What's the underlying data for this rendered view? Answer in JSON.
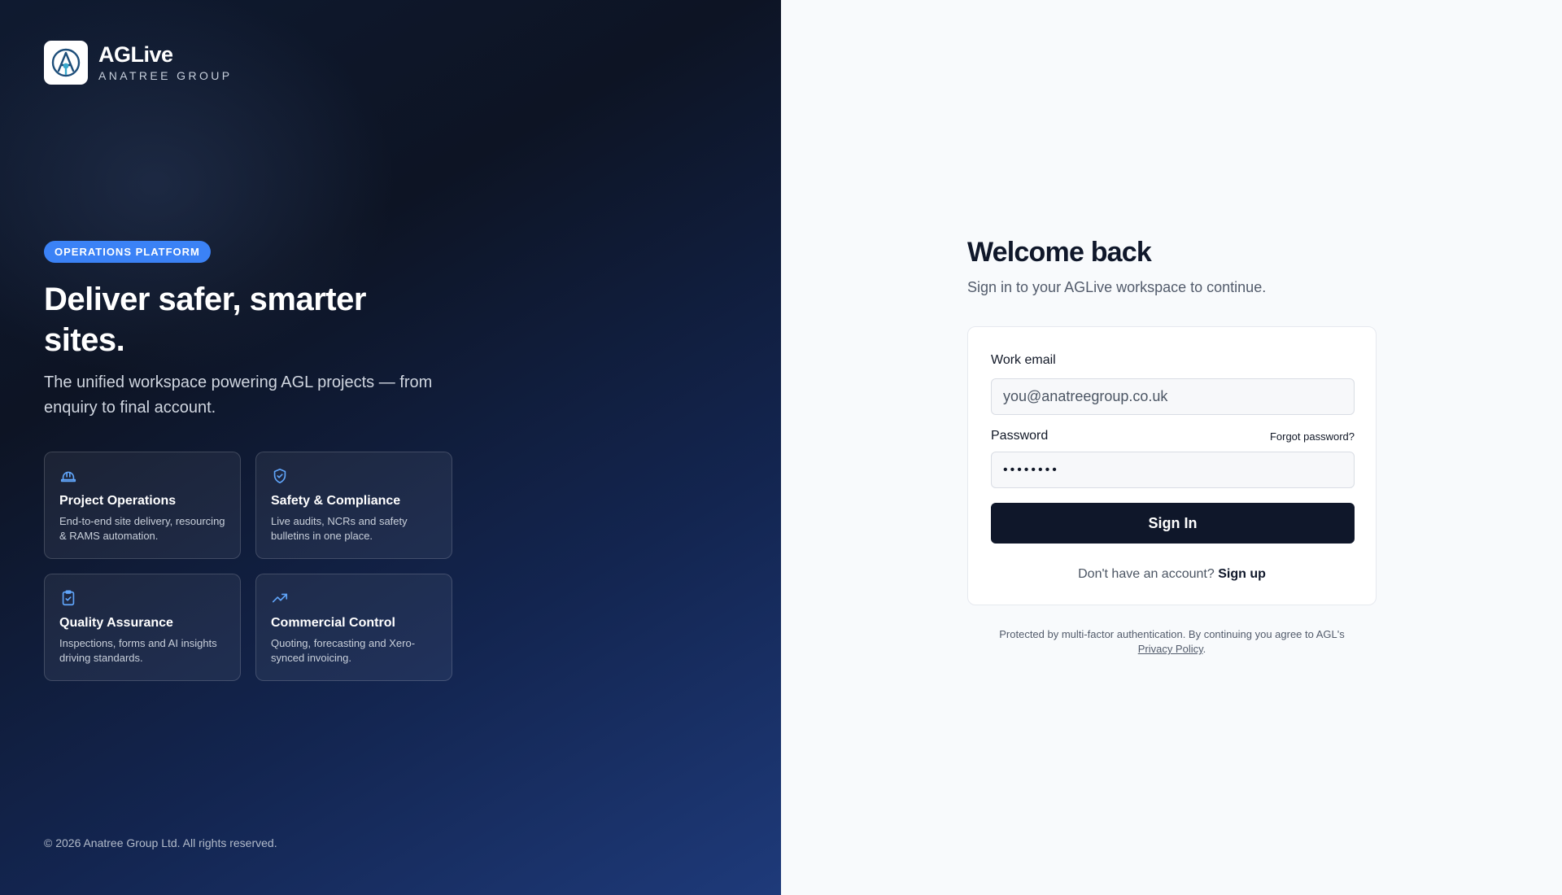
{
  "brand": {
    "name": "AGLive",
    "subtitle": "ANATREE GROUP",
    "accent": "#3b82f6"
  },
  "hero": {
    "badge": "OPERATIONS PLATFORM",
    "headline": "Deliver safer, smarter sites.",
    "lede": "The unified workspace powering AGL projects — from enquiry to final account."
  },
  "features": [
    {
      "icon": "hard-hat-icon",
      "title": "Project Operations",
      "desc": "End-to-end site delivery, resourcing & RAMS automation."
    },
    {
      "icon": "shield-check-icon",
      "title": "Safety & Compliance",
      "desc": "Live audits, NCRs and safety bulletins in one place."
    },
    {
      "icon": "clipboard-check-icon",
      "title": "Quality Assurance",
      "desc": "Inspections, forms and AI insights driving standards."
    },
    {
      "icon": "trending-up-icon",
      "title": "Commercial Control",
      "desc": "Quoting, forecasting and Xero-synced invoicing."
    }
  ],
  "footer": {
    "copyright": "© 2026 Anatree Group Ltd. All rights reserved."
  },
  "login": {
    "title": "Welcome back",
    "subtitle": "Sign in to your AGLive workspace to continue.",
    "email_label": "Work email",
    "email_placeholder": "you@anatreegroup.co.uk",
    "password_label": "Password",
    "forgot_label": "Forgot password?",
    "password_value": "••••••••",
    "submit_label": "Sign In",
    "no_account_text": "Don't have an account?",
    "signup_label": "Sign up",
    "button_color": "#0f172a"
  },
  "legal": {
    "text": "Protected by multi-factor authentication. By continuing you agree to AGL's",
    "policy_link": "Privacy Policy",
    "end": "."
  }
}
